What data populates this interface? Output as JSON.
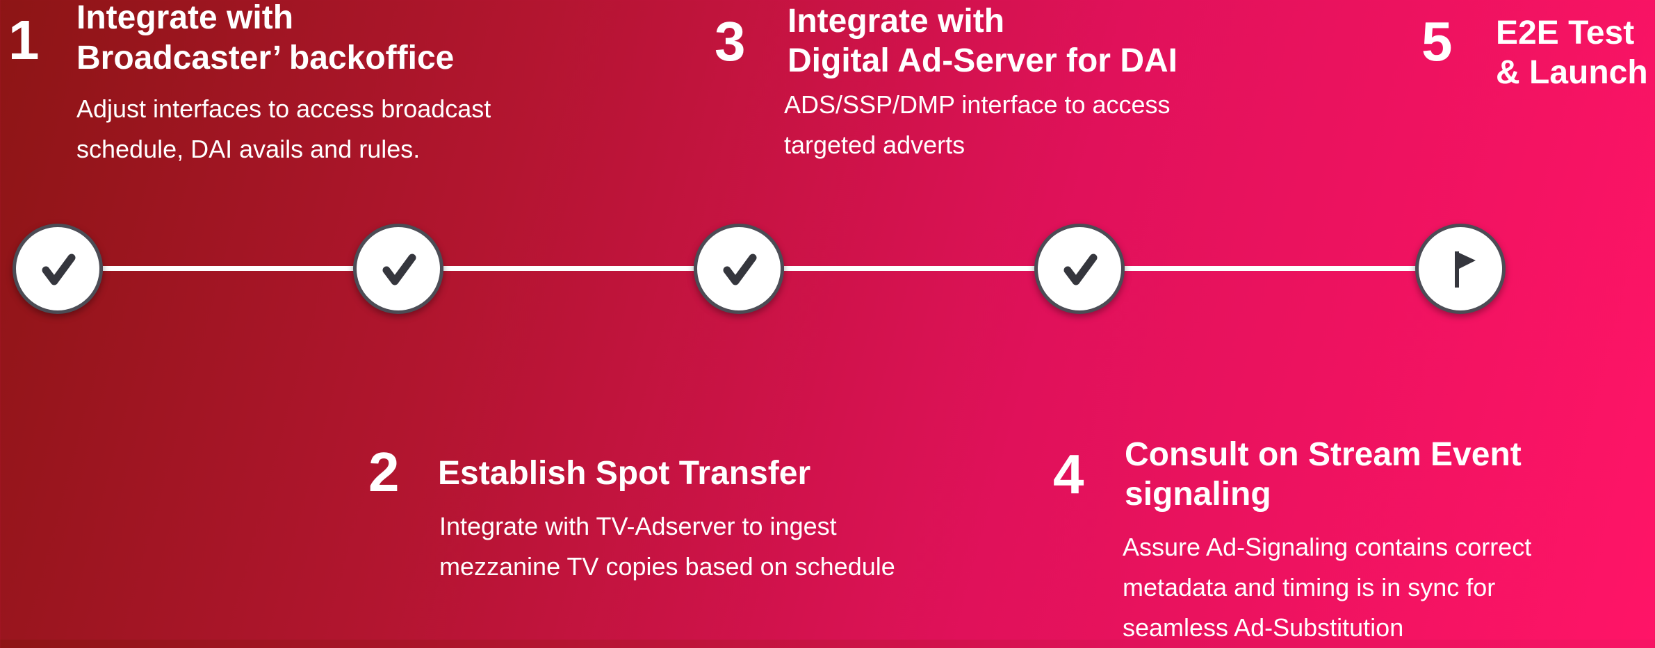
{
  "steps": [
    {
      "number": "1",
      "title_line1": "Integrate with",
      "title_line2": "Broadcaster’ backoffice",
      "desc_line1": "Adjust interfaces to access broadcast",
      "desc_line2": "schedule, DAI avails and rules."
    },
    {
      "number": "2",
      "title_line1": "Establish Spot Transfer",
      "desc_line1": "Integrate with TV-Adserver to ingest",
      "desc_line2": "mezzanine TV copies based on schedule"
    },
    {
      "number": "3",
      "title_line1": "Integrate with",
      "title_line2": "Digital Ad-Server for DAI",
      "desc_line1": "ADS/SSP/DMP interface to access",
      "desc_line2": "targeted adverts"
    },
    {
      "number": "4",
      "title_line1": "Consult on Stream Event",
      "title_line2": "signaling",
      "desc_line1": "Assure Ad-Signaling contains correct",
      "desc_line2": "metadata and timing is in sync for",
      "desc_line3": "seamless Ad-Substitution"
    },
    {
      "number": "5",
      "title_line1": "E2E Test",
      "title_line2": "& Launch"
    }
  ],
  "timeline": {
    "nodes": [
      {
        "icon": "check-icon",
        "status": "done"
      },
      {
        "icon": "check-icon",
        "status": "done"
      },
      {
        "icon": "check-icon",
        "status": "done"
      },
      {
        "icon": "check-icon",
        "status": "done"
      },
      {
        "icon": "flag-icon",
        "status": "pending"
      }
    ]
  },
  "colors": {
    "gradient_start": "#8d1515",
    "gradient_end": "#ff1467",
    "node_fill": "#ffffff",
    "node_border": "#4c4c55",
    "icon": "#35363d",
    "line": "#ffffff",
    "text": "#ffffff"
  }
}
